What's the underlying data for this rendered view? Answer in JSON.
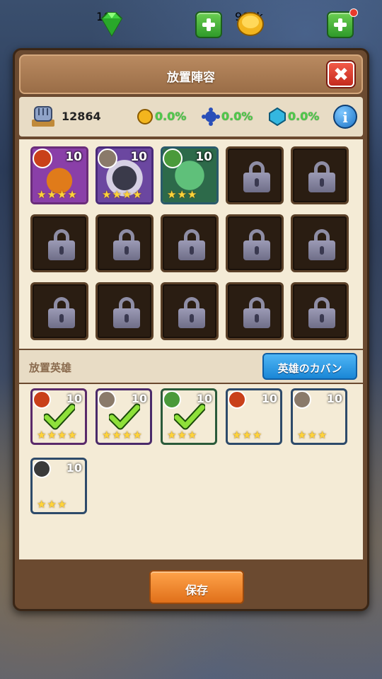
{
  "currency": {
    "gems": "165",
    "coins": "964k"
  },
  "panel": {
    "title": "放置陣容",
    "close_label": "✖"
  },
  "stats": {
    "power": "12864",
    "gold_bonus": "0.0%",
    "exp_bonus": "0.0%",
    "crystal_bonus": "0.0%",
    "info_label": "i"
  },
  "team": {
    "heroes": [
      {
        "level": "10",
        "stars": 4,
        "element": "fire-icon",
        "color": "#8a3fa8"
      },
      {
        "level": "10",
        "stars": 4,
        "element": "wind-icon",
        "color": "#6b47a0"
      },
      {
        "level": "10",
        "stars": 3,
        "element": "nature-icon",
        "color": "#3a8a55"
      }
    ],
    "locked_slots": 12
  },
  "idle_heroes": {
    "title": "放置英雄",
    "bag_button": "英雄のカバン",
    "cards": [
      {
        "level": "10",
        "stars": 4,
        "element": "fire-icon",
        "selected": true
      },
      {
        "level": "10",
        "stars": 4,
        "element": "wind-icon",
        "selected": true
      },
      {
        "level": "10",
        "stars": 3,
        "element": "nature-icon",
        "selected": true
      },
      {
        "level": "10",
        "stars": 3,
        "element": "fire-icon",
        "selected": false
      },
      {
        "level": "10",
        "stars": 3,
        "element": "wind-icon",
        "selected": false
      },
      {
        "level": "10",
        "stars": 3,
        "element": "dark-icon",
        "selected": false
      }
    ]
  },
  "footer": {
    "save_label": "保存"
  }
}
